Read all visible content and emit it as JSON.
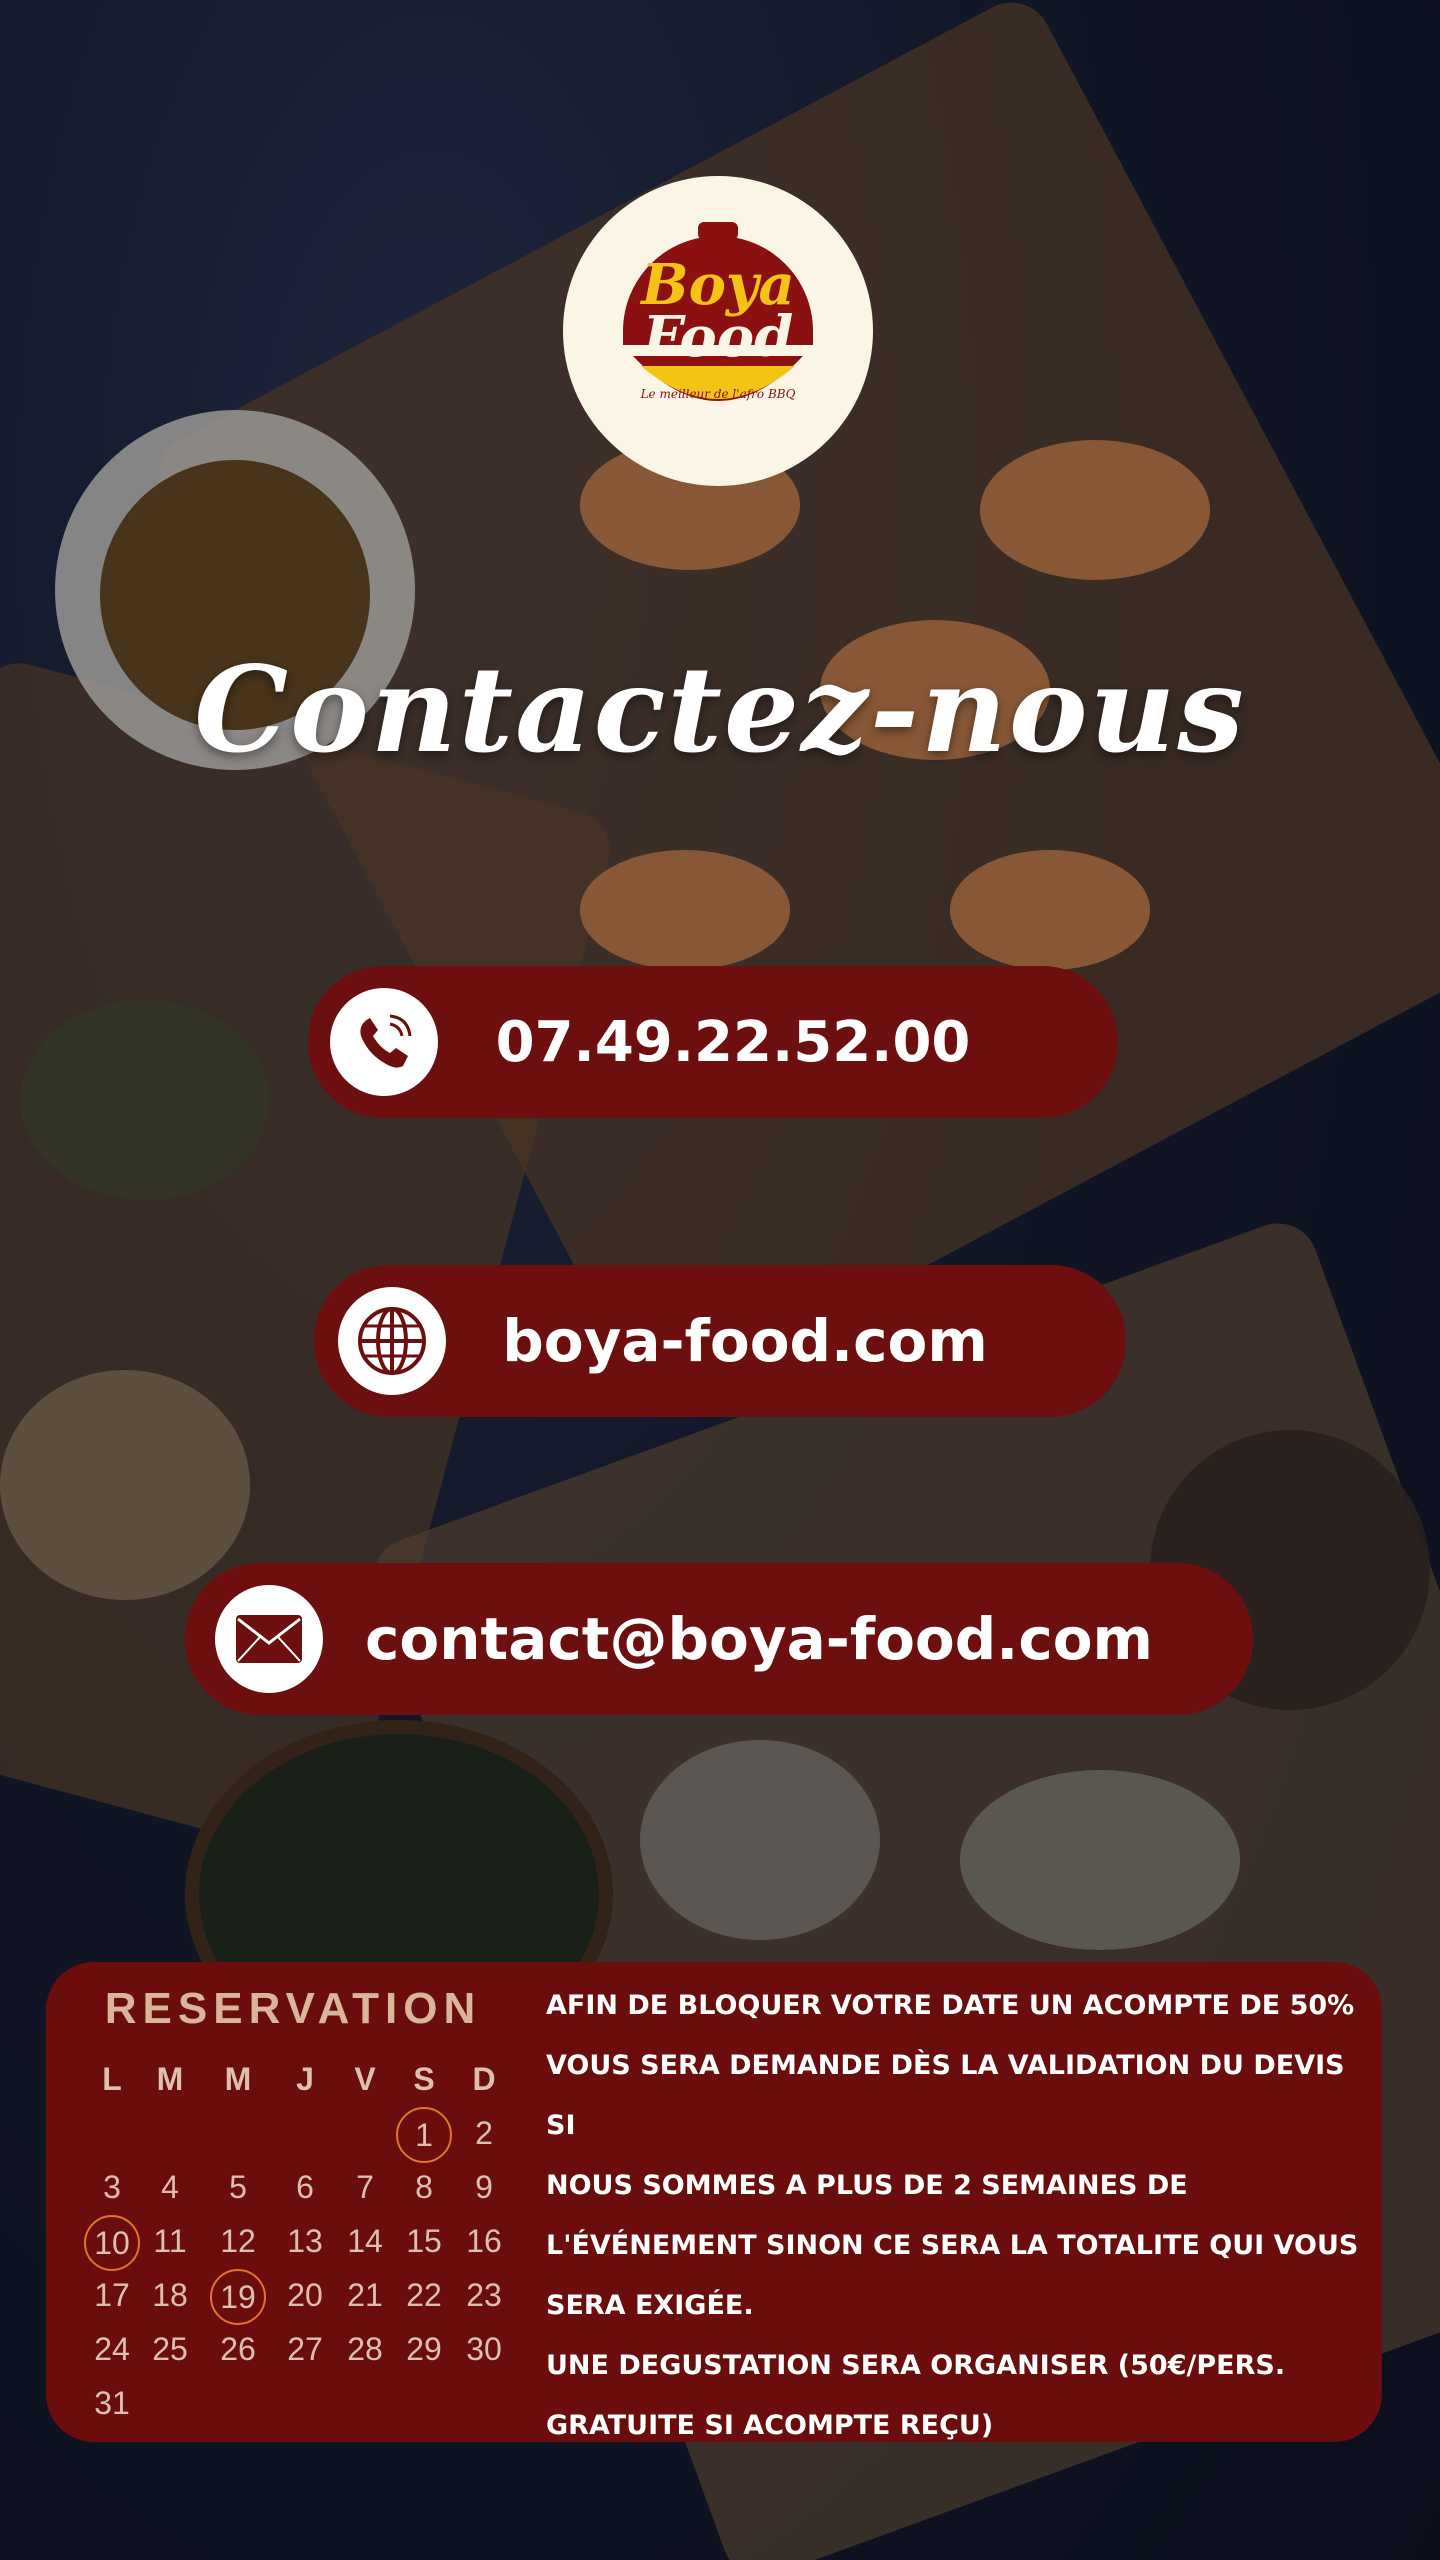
{
  "header": {
    "brand_line1": "Boya",
    "brand_line2": "Food",
    "brand_tagline": "Le meilleur de l'afro BBQ",
    "title": "Contactez-nous"
  },
  "contacts": {
    "phone": {
      "label": "07.49.22.52.00",
      "icon": "phone-icon"
    },
    "website": {
      "label": "boya-food.com",
      "icon": "globe-icon"
    },
    "email": {
      "label": "contact@boya-food.com",
      "icon": "envelope-icon"
    }
  },
  "reservation": {
    "title": "RESERVATION",
    "weekdays": [
      "L",
      "M",
      "M",
      "J",
      "V",
      "S",
      "D"
    ],
    "weeks": [
      [
        "",
        "",
        "",
        "",
        "",
        "1",
        "2"
      ],
      [
        "3",
        "4",
        "5",
        "6",
        "7",
        "8",
        "9"
      ],
      [
        "10",
        "11",
        "12",
        "13",
        "14",
        "15",
        "16"
      ],
      [
        "17",
        "18",
        "19",
        "20",
        "21",
        "22",
        "23"
      ],
      [
        "24",
        "25",
        "26",
        "27",
        "28",
        "29",
        "30"
      ],
      [
        "31",
        "",
        "",
        "",
        "",
        "",
        ""
      ]
    ],
    "highlighted_days": [
      "1",
      "10",
      "19"
    ],
    "info_lines": [
      "AFIN DE BLOQUER VOTRE DATE UN ACOMPTE DE 50%",
      "VOUS SERA DEMANDE DÈS LA VALIDATION DU DEVIS SI",
      "NOUS SOMMES A PLUS DE 2 SEMAINES DE",
      "L'ÉVÉNEMENT SINON CE SERA LA TOTALITE QUI VOUS",
      "SERA EXIGÉE.",
      "UNE DEGUSTATION SERA ORGANISER (50€/PERS.",
      "GRATUITE SI ACOMPTE REÇU)"
    ]
  },
  "colors": {
    "pill_red": "#6e0f0f",
    "panel_red": "#6b0d0d",
    "logo_yellow": "#f4c316",
    "circle_orange": "#e0742e"
  }
}
